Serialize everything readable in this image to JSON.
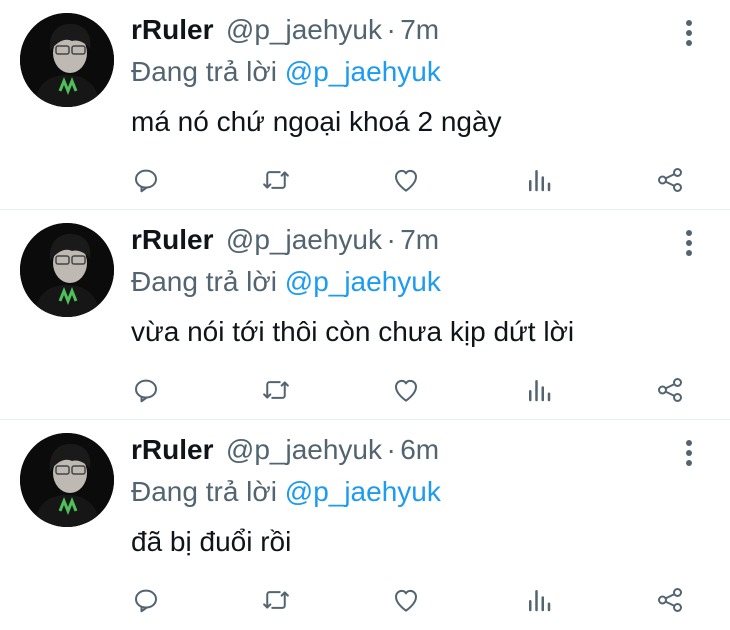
{
  "colors": {
    "text": "#0f1419",
    "secondary": "#536471",
    "link": "#1d9bf0",
    "divider": "#e6ecf0",
    "background": "#ffffff"
  },
  "tweets": [
    {
      "display_name": "rRuler",
      "handle": "@p_jaehyuk",
      "separator": "·",
      "time": "7m",
      "reply_prefix": "Đang trả lời",
      "reply_to": "@p_jaehyuk",
      "text": "má nó chứ ngoại khoá 2 ngày",
      "icons": [
        "avatar-photo",
        "more-vertical-icon",
        "reply-icon",
        "retweet-icon",
        "like-icon",
        "analytics-icon",
        "share-icon"
      ]
    },
    {
      "display_name": "rRuler",
      "handle": "@p_jaehyuk",
      "separator": "·",
      "time": "7m",
      "reply_prefix": "Đang trả lời",
      "reply_to": "@p_jaehyuk",
      "text": "vừa nói tới thôi còn chưa kịp dứt lời",
      "icons": [
        "avatar-photo",
        "more-vertical-icon",
        "reply-icon",
        "retweet-icon",
        "like-icon",
        "analytics-icon",
        "share-icon"
      ]
    },
    {
      "display_name": "rRuler",
      "handle": "@p_jaehyuk",
      "separator": "·",
      "time": "6m",
      "reply_prefix": "Đang trả lời",
      "reply_to": "@p_jaehyuk",
      "text": "đã bị đuổi rồi",
      "icons": [
        "avatar-photo",
        "more-vertical-icon",
        "reply-icon",
        "retweet-icon",
        "like-icon",
        "analytics-icon",
        "share-icon"
      ]
    }
  ]
}
